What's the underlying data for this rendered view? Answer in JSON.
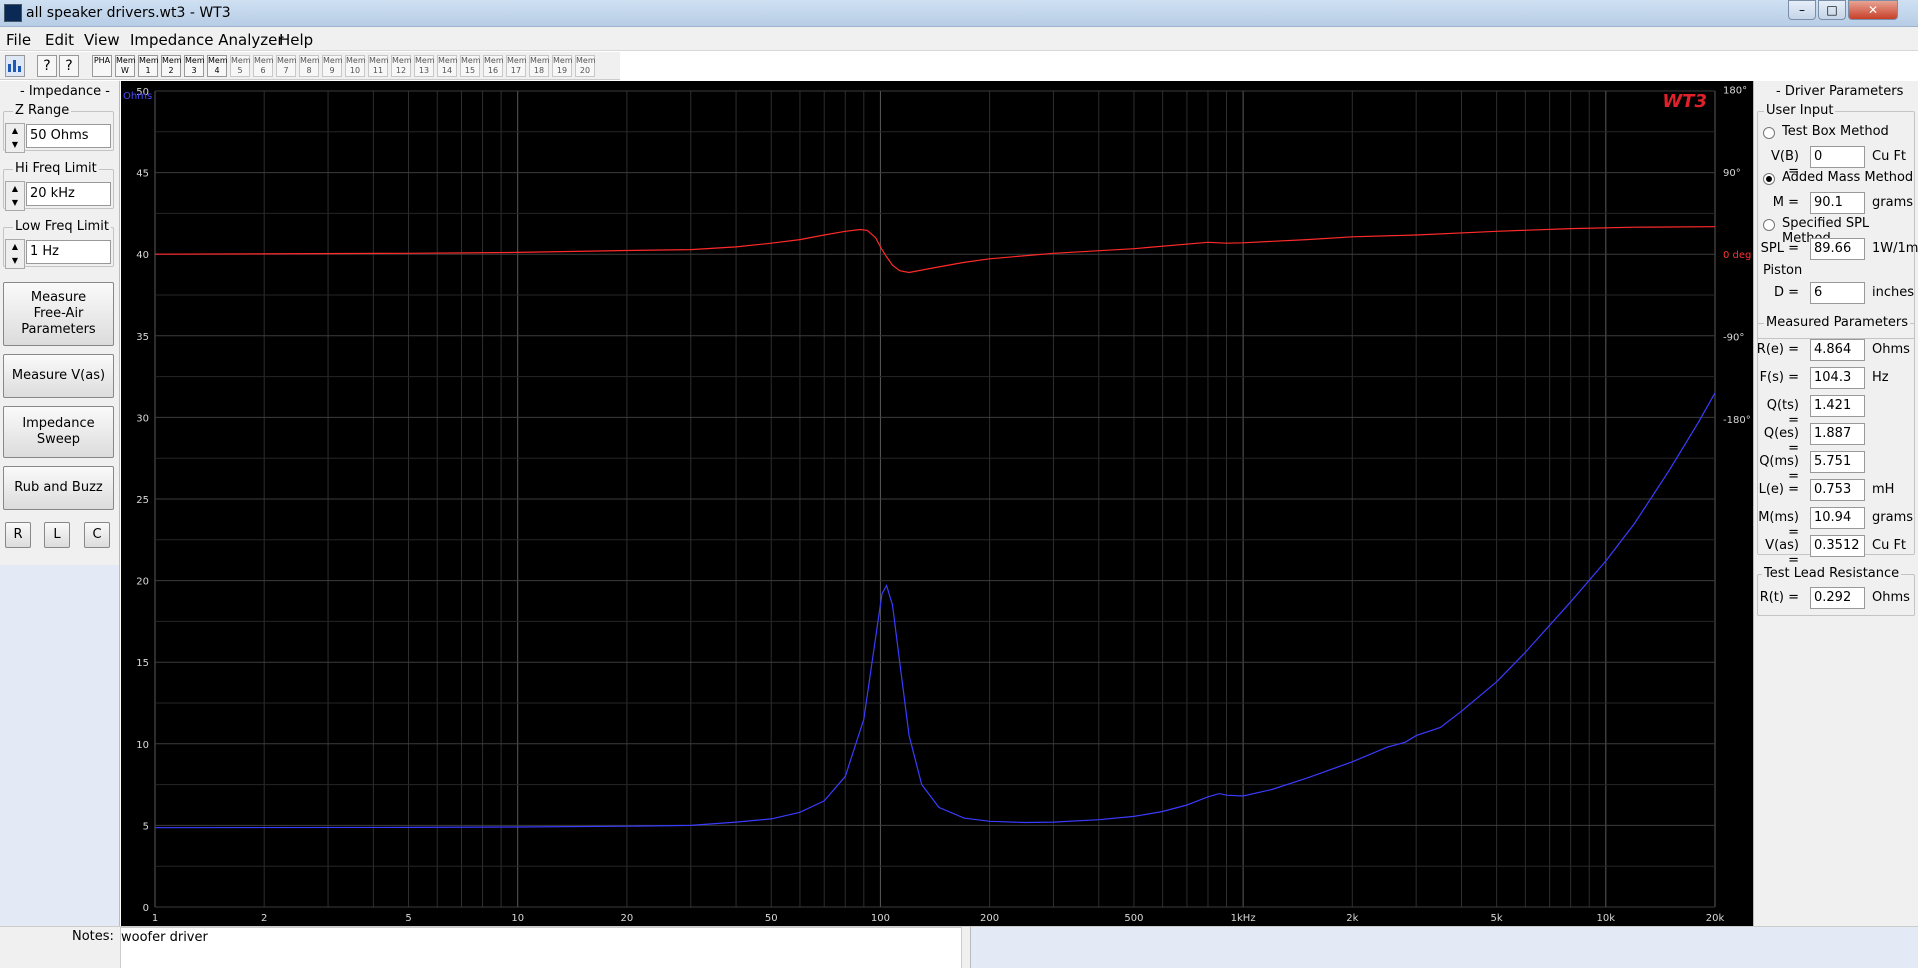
{
  "window": {
    "title": "all speaker drivers.wt3 - WT3",
    "minimize": "–",
    "maximize": "□",
    "close": "✕"
  },
  "menu": [
    "File",
    "Edit",
    "View",
    "Impedance Analyzer",
    "Help"
  ],
  "toolbar": {
    "buttons": [
      "PHA",
      "Mem W",
      "Mem 1",
      "Mem 2",
      "Mem 3",
      "Mem 4",
      "Mem 5",
      "Mem 6",
      "Mem 7",
      "Mem 8",
      "Mem 9",
      "Mem 10",
      "Mem 11",
      "Mem 12",
      "Mem 13",
      "Mem 14",
      "Mem 15",
      "Mem 16",
      "Mem 17",
      "Mem 18",
      "Mem 19",
      "Mem 20"
    ]
  },
  "left": {
    "group_title": "- Impedance -",
    "z_range": {
      "label": "Z Range",
      "value": "50 Ohms"
    },
    "hi_freq": {
      "label": "Hi Freq Limit",
      "value": "20 kHz"
    },
    "low_freq": {
      "label": "Low Freq Limit",
      "value": "1 Hz"
    },
    "buttons": {
      "free_air": "Measure\nFree-Air\nParameters",
      "vas": "Measure V(as)",
      "sweep": "Impedance\nSweep",
      "rub": "Rub and Buzz",
      "r": "R",
      "l": "L",
      "c": "C"
    }
  },
  "right": {
    "title": "- Driver Parameters",
    "user_input": "User Input",
    "test_box": "Test Box Method",
    "vb": {
      "label": "V(B) =",
      "value": "0",
      "unit": "Cu Ft"
    },
    "added_mass": "Added Mass Method",
    "m": {
      "label": "M =",
      "value": "90.1",
      "unit": "grams"
    },
    "spec_spl": "Specified SPL Method",
    "spl": {
      "label": "SPL =",
      "value": "89.66",
      "unit": "1W/1m"
    },
    "piston": "Piston",
    "d": {
      "label": "D =",
      "value": "6",
      "unit": "inches"
    },
    "measured_title": "Measured Parameters",
    "measured": [
      {
        "label": "R(e) =",
        "value": "4.864",
        "unit": "Ohms"
      },
      {
        "label": "F(s) =",
        "value": "104.3",
        "unit": "Hz"
      },
      {
        "label": "Q(ts) =",
        "value": "1.421",
        "unit": ""
      },
      {
        "label": "Q(es) =",
        "value": "1.887",
        "unit": ""
      },
      {
        "label": "Q(ms) =",
        "value": "5.751",
        "unit": ""
      },
      {
        "label": "L(e) =",
        "value": "0.753",
        "unit": "mH"
      },
      {
        "label": "M(ms) =",
        "value": "10.94",
        "unit": "grams"
      },
      {
        "label": "V(as) =",
        "value": "0.3512",
        "unit": "Cu Ft"
      }
    ],
    "lead_title": "Test Lead Resistance",
    "rt": {
      "label": "R(t) =",
      "value": "0.292",
      "unit": "Ohms"
    }
  },
  "notes": {
    "label": "Notes:",
    "value": "woofer driver"
  },
  "chart_data": {
    "type": "line",
    "logo": "WT3",
    "left_unit": "Ohms",
    "right_unit": "0 deg",
    "x_scale": "log",
    "xlim": [
      1,
      20000
    ],
    "ylim": [
      0,
      50
    ],
    "phase_lim": [
      -180,
      180
    ],
    "x_ticks": [
      {
        "v": 1,
        "t": "1"
      },
      {
        "v": 2,
        "t": "2"
      },
      {
        "v": 5,
        "t": "5"
      },
      {
        "v": 10,
        "t": "10"
      },
      {
        "v": 20,
        "t": "20"
      },
      {
        "v": 50,
        "t": "50"
      },
      {
        "v": 100,
        "t": "100"
      },
      {
        "v": 200,
        "t": "200"
      },
      {
        "v": 500,
        "t": "500"
      },
      {
        "v": 1000,
        "t": "1kHz"
      },
      {
        "v": 2000,
        "t": "2k"
      },
      {
        "v": 5000,
        "t": "5k"
      },
      {
        "v": 10000,
        "t": "10k"
      },
      {
        "v": 20000,
        "t": "20k"
      }
    ],
    "y_ticks": [
      "0",
      "5",
      "10",
      "15",
      "20",
      "25",
      "30",
      "35",
      "40",
      "45",
      "50"
    ],
    "phase_ticks": [
      {
        "v": 180,
        "t": "180°"
      },
      {
        "v": 90,
        "t": "90°"
      },
      {
        "v": -90,
        "t": "-90°"
      },
      {
        "v": -180,
        "t": "-180°"
      }
    ],
    "grid": true,
    "series": [
      {
        "color": "#3b3bff",
        "axis": "impedance",
        "points": [
          [
            1,
            4.86
          ],
          [
            5,
            4.88
          ],
          [
            10,
            4.9
          ],
          [
            20,
            4.95
          ],
          [
            30,
            5.0
          ],
          [
            40,
            5.2
          ],
          [
            50,
            5.4
          ],
          [
            60,
            5.8
          ],
          [
            70,
            6.5
          ],
          [
            80,
            8.0
          ],
          [
            90,
            11.5
          ],
          [
            97,
            16.5
          ],
          [
            101,
            19.2
          ],
          [
            104,
            19.7
          ],
          [
            108,
            18.5
          ],
          [
            113,
            15.0
          ],
          [
            120,
            10.5
          ],
          [
            130,
            7.5
          ],
          [
            145,
            6.1
          ],
          [
            170,
            5.45
          ],
          [
            200,
            5.25
          ],
          [
            250,
            5.18
          ],
          [
            300,
            5.2
          ],
          [
            400,
            5.35
          ],
          [
            500,
            5.55
          ],
          [
            600,
            5.85
          ],
          [
            700,
            6.25
          ],
          [
            800,
            6.75
          ],
          [
            860,
            6.95
          ],
          [
            900,
            6.85
          ],
          [
            1000,
            6.8
          ],
          [
            1200,
            7.2
          ],
          [
            1500,
            7.9
          ],
          [
            2000,
            8.9
          ],
          [
            2500,
            9.8
          ],
          [
            2800,
            10.1
          ],
          [
            3000,
            10.5
          ],
          [
            3500,
            11.0
          ],
          [
            4000,
            12.0
          ],
          [
            5000,
            13.8
          ],
          [
            6000,
            15.6
          ],
          [
            8000,
            18.7
          ],
          [
            10000,
            21.2
          ],
          [
            12000,
            23.5
          ],
          [
            15000,
            26.8
          ],
          [
            18000,
            29.7
          ],
          [
            20000,
            31.5
          ]
        ]
      },
      {
        "color": "#ff2a2a",
        "axis": "phase",
        "points": [
          [
            1,
            0
          ],
          [
            5,
            1
          ],
          [
            10,
            2
          ],
          [
            20,
            4
          ],
          [
            30,
            5
          ],
          [
            40,
            8
          ],
          [
            50,
            12
          ],
          [
            60,
            16
          ],
          [
            70,
            21
          ],
          [
            80,
            25
          ],
          [
            88,
            27
          ],
          [
            92,
            26
          ],
          [
            97,
            18
          ],
          [
            101,
            5
          ],
          [
            104,
            -3
          ],
          [
            108,
            -12
          ],
          [
            113,
            -18
          ],
          [
            120,
            -20
          ],
          [
            140,
            -15
          ],
          [
            170,
            -9
          ],
          [
            200,
            -5
          ],
          [
            300,
            1
          ],
          [
            500,
            6
          ],
          [
            800,
            13
          ],
          [
            900,
            12
          ],
          [
            1000,
            12.5
          ],
          [
            1500,
            16
          ],
          [
            2000,
            19
          ],
          [
            3000,
            21
          ],
          [
            5000,
            25
          ],
          [
            8000,
            28
          ],
          [
            12000,
            29.5
          ],
          [
            20000,
            30
          ]
        ]
      }
    ]
  }
}
